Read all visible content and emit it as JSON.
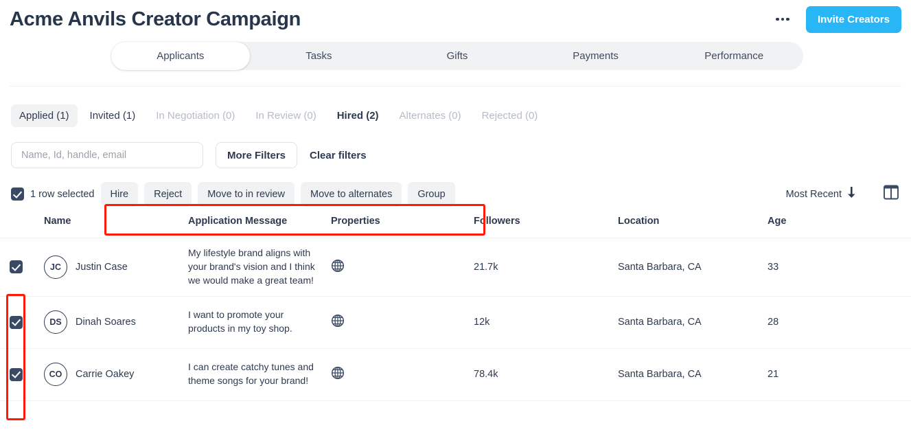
{
  "header": {
    "title": "Acme Anvils Creator Campaign",
    "kebab_icon": "more-horizontal-icon",
    "invite_label": "Invite Creators",
    "accent_color": "#29b6f6"
  },
  "tabs": {
    "active": "Applicants",
    "items": [
      {
        "label": "Applicants"
      },
      {
        "label": "Tasks"
      },
      {
        "label": "Gifts"
      },
      {
        "label": "Payments"
      },
      {
        "label": "Performance"
      }
    ]
  },
  "status_filters": [
    {
      "label": "Applied (1)",
      "state": "selected"
    },
    {
      "label": "Invited (1)",
      "state": "normal"
    },
    {
      "label": "In Negotiation (0)",
      "state": "muted"
    },
    {
      "label": "In Review (0)",
      "state": "muted"
    },
    {
      "label": "Hired (2)",
      "state": "strong"
    },
    {
      "label": "Alternates (0)",
      "state": "muted"
    },
    {
      "label": "Rejected (0)",
      "state": "muted"
    }
  ],
  "search": {
    "value": "",
    "placeholder": "Name, Id, handle, email",
    "more_filters_label": "More Filters",
    "clear_filters_label": "Clear filters"
  },
  "bulk": {
    "selected_label": "1 row selected",
    "master_checkbox_checked": true,
    "actions": [
      {
        "label": "Hire"
      },
      {
        "label": "Reject"
      },
      {
        "label": "Move to in review"
      },
      {
        "label": "Move to alternates"
      },
      {
        "label": "Group"
      }
    ],
    "sort_label": "Most Recent",
    "sort_icon": "arrow-down-icon",
    "columns_icon": "columns-layout-icon",
    "highlight_color": "#ff1a06"
  },
  "table": {
    "columns": [
      "Name",
      "Application Message",
      "Properties",
      "Followers",
      "Location",
      "Age"
    ],
    "rows": [
      {
        "checked": true,
        "initials": "JC",
        "name": "Justin Case",
        "message": "My lifestyle brand aligns with your brand's vision and I think we would make a great team!",
        "property_icon": "globe-icon",
        "followers": "21.7k",
        "location": "Santa Barbara, CA",
        "age": "33"
      },
      {
        "checked": true,
        "initials": "DS",
        "name": "Dinah Soares",
        "message": "I want to promote your products in my toy shop.",
        "property_icon": "globe-icon",
        "followers": "12k",
        "location": "Santa Barbara, CA",
        "age": "28"
      },
      {
        "checked": true,
        "initials": "CO",
        "name": "Carrie Oakey",
        "message": "I can create catchy tunes and theme songs for your brand!",
        "property_icon": "globe-icon",
        "followers": "78.4k",
        "location": "Santa Barbara, CA",
        "age": "21"
      }
    ]
  }
}
